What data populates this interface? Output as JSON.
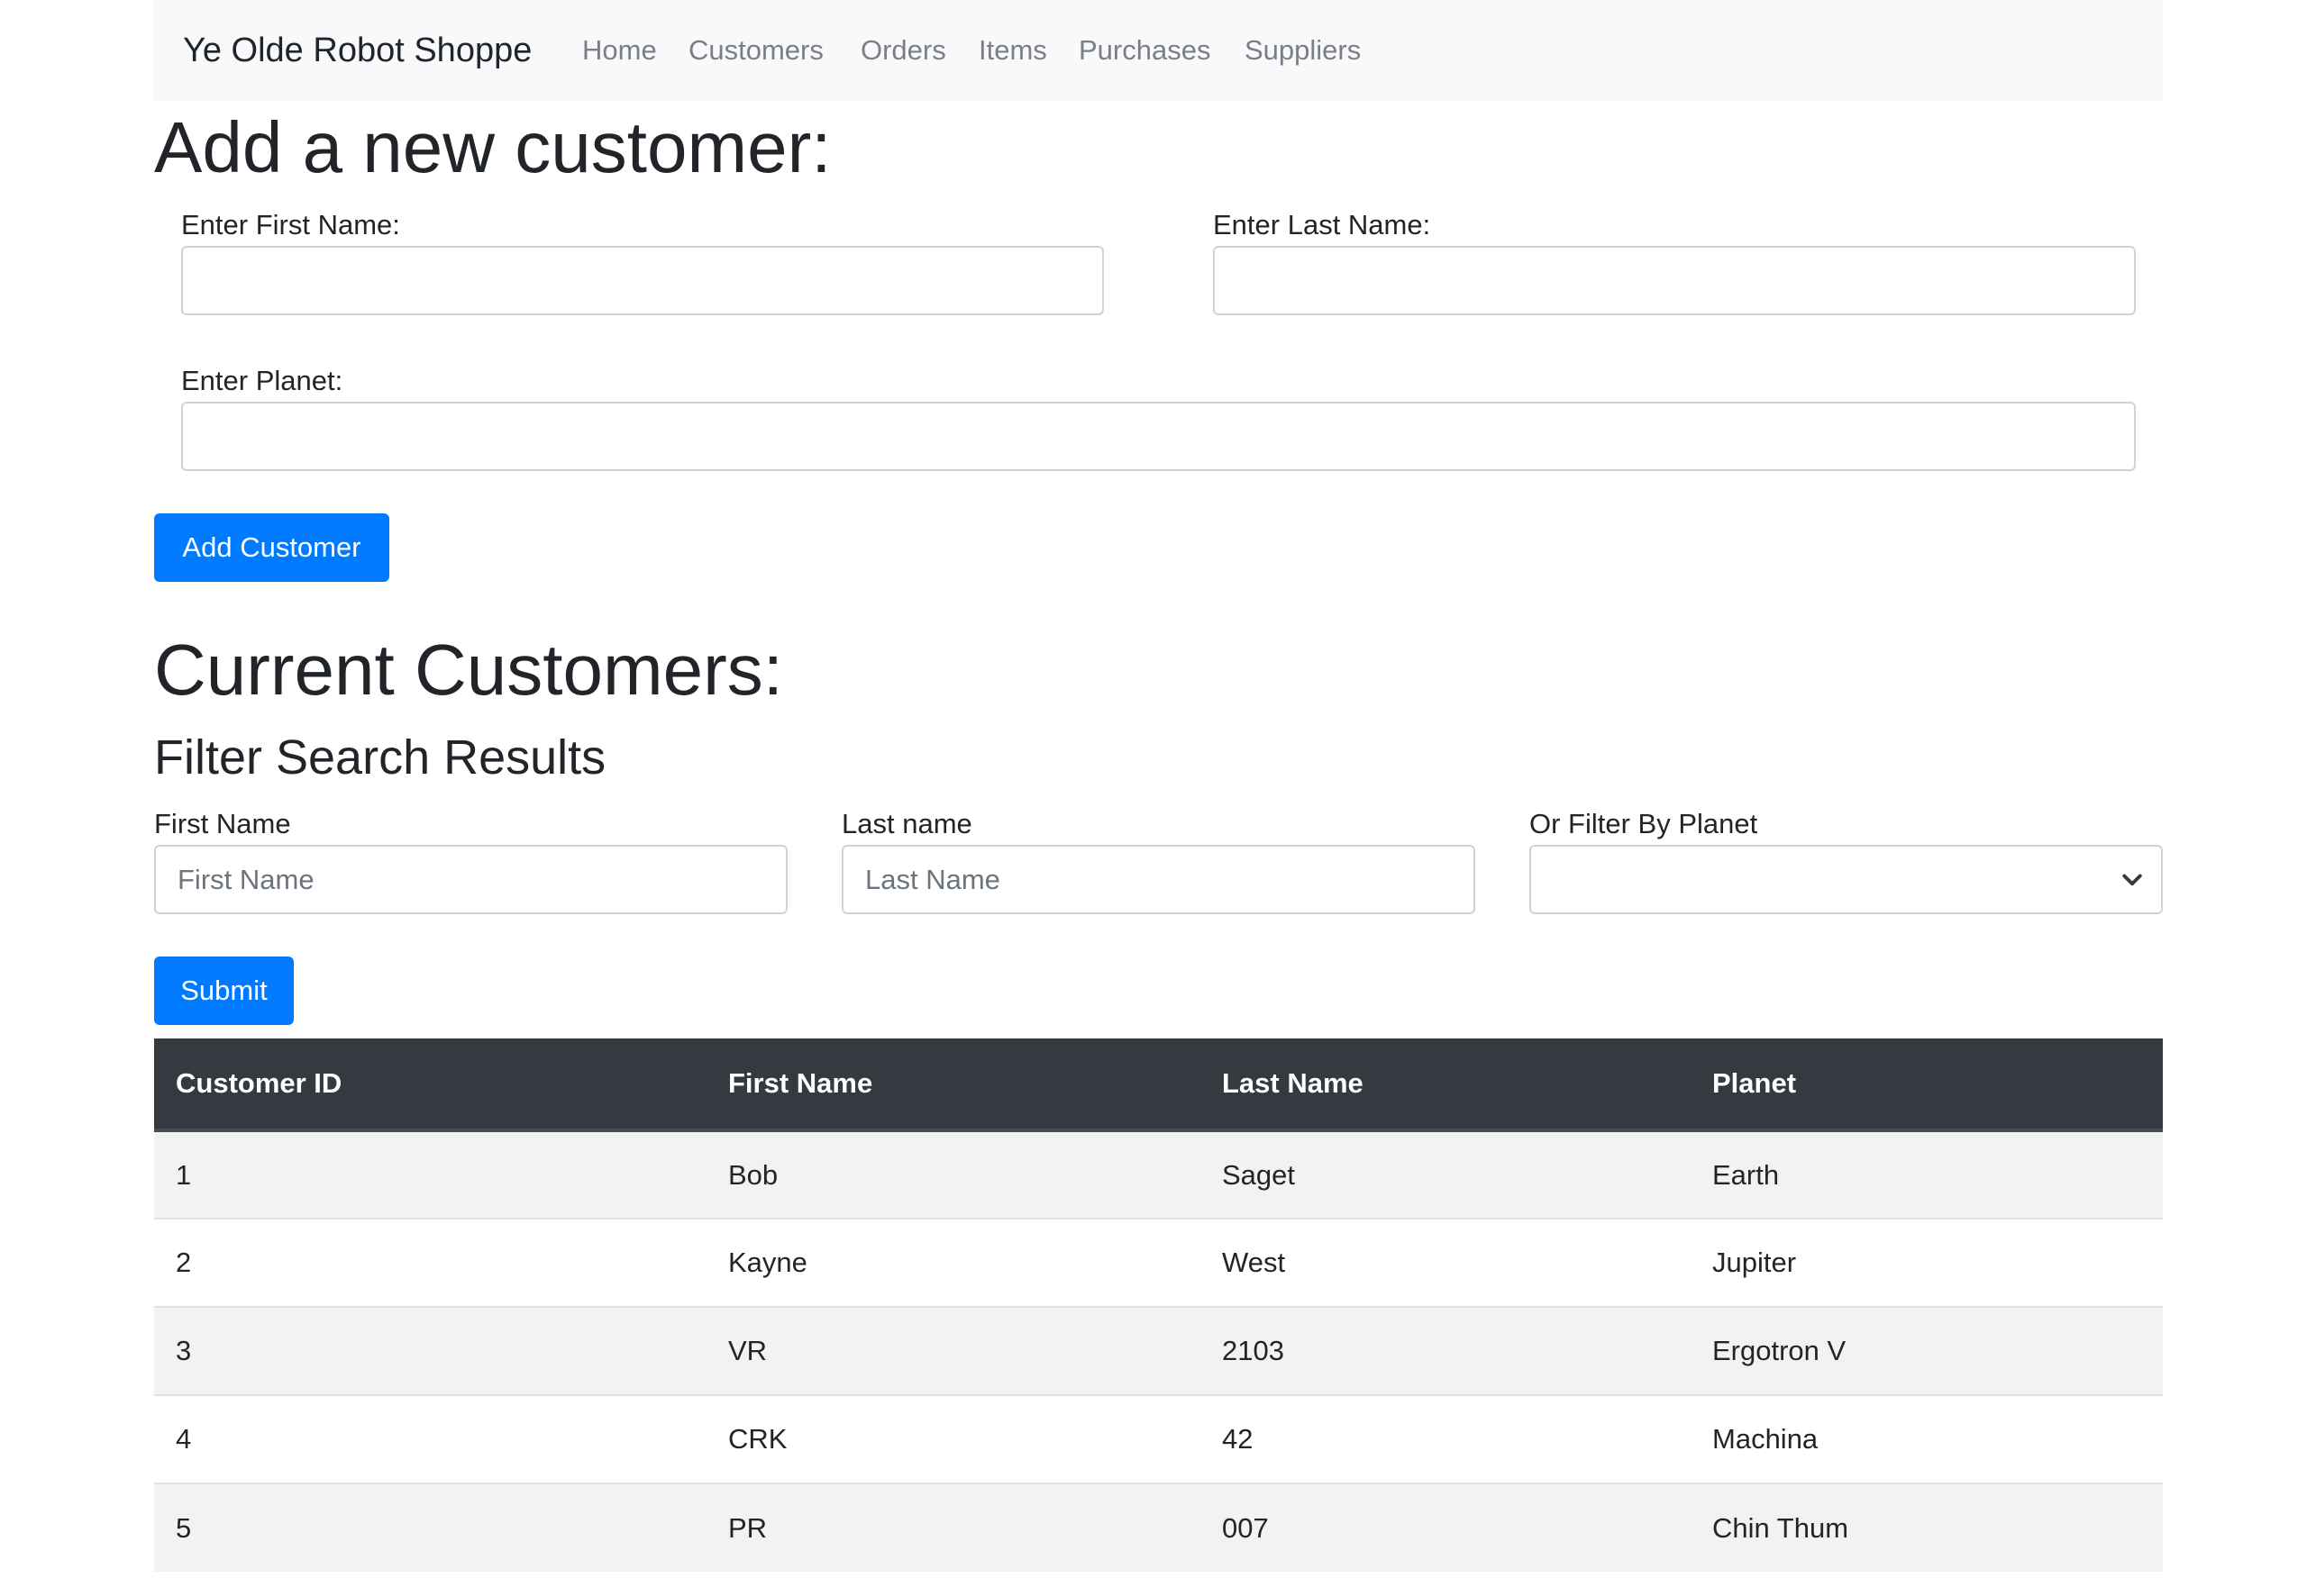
{
  "navbar": {
    "brand": "Ye Olde Robot Shoppe",
    "links": [
      "Home",
      "Customers",
      "Orders",
      "Items",
      "Purchases",
      "Suppliers"
    ]
  },
  "add_form": {
    "heading": "Add a new customer:",
    "first_name_label": "Enter First Name:",
    "first_name_value": "",
    "last_name_label": "Enter Last Name:",
    "last_name_value": "",
    "planet_label": "Enter Planet:",
    "planet_value": "",
    "submit_label": "Add Customer"
  },
  "customers": {
    "heading": "Current Customers:",
    "filter_heading": "Filter Search Results",
    "first_name_label": "First Name",
    "first_name_placeholder": "First Name",
    "last_name_label": "Last name",
    "last_name_placeholder": "Last Name",
    "planet_label": "Or Filter By Planet",
    "planet_selected": "",
    "submit_label": "Submit"
  },
  "table": {
    "columns": [
      "Customer ID",
      "First Name",
      "Last Name",
      "Planet"
    ],
    "rows": [
      [
        "1",
        "Bob",
        "Saget",
        "Earth"
      ],
      [
        "2",
        "Kayne",
        "West",
        "Jupiter"
      ],
      [
        "3",
        "VR",
        "2103",
        "Ergotron V"
      ],
      [
        "4",
        "CRK",
        "42",
        "Machina"
      ],
      [
        "5",
        "PR",
        "007",
        "Chin Thum"
      ]
    ]
  },
  "colors": {
    "primary": "#007bff",
    "navbar_bg": "#f8f9fa",
    "table_head_bg": "#343a40",
    "stripe_bg": "#f2f2f2"
  },
  "icons": {
    "select_arrow": "chevron-down-icon"
  }
}
